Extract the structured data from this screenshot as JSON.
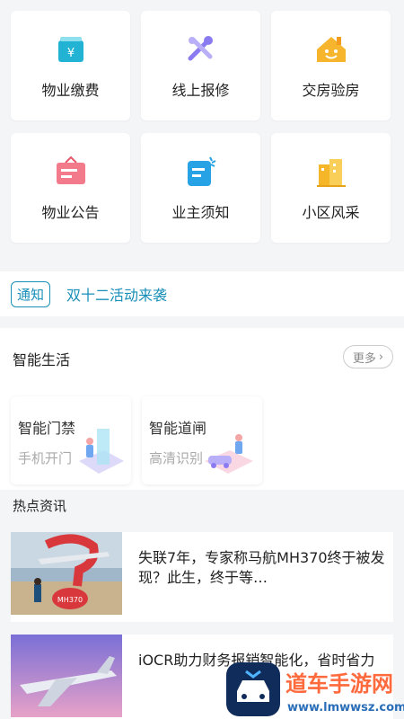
{
  "services": [
    {
      "label": "物业缴费",
      "icon": "wallet-yen-icon"
    },
    {
      "label": "线上报修",
      "icon": "tools-icon"
    },
    {
      "label": "交房验房",
      "icon": "house-smile-icon"
    },
    {
      "label": "物业公告",
      "icon": "announcement-board-icon"
    },
    {
      "label": "业主须知",
      "icon": "notice-doc-icon"
    },
    {
      "label": "小区风采",
      "icon": "buildings-icon"
    }
  ],
  "notice": {
    "tag": "通知",
    "text": "双十二活动来袭"
  },
  "smart_life": {
    "title": "智能生活",
    "more": "更多",
    "cards": [
      {
        "title": "智能门禁",
        "subtitle": "手机开门"
      },
      {
        "title": "智能道闸",
        "subtitle": "高清识别"
      }
    ]
  },
  "hot_news": {
    "title": "热点资讯",
    "items": [
      {
        "title": "失联7年，专家称马航MH370终于被发现？此生，终于等…",
        "thumb_text": "MH370"
      },
      {
        "title": "iOCR助力财务报销智能化，省时省力"
      }
    ]
  },
  "watermark": {
    "name": "道车手游网",
    "url": "www.lmwwsz.com"
  },
  "colors": {
    "accent": "#1a8fb8",
    "background": "#f4f5f7"
  }
}
